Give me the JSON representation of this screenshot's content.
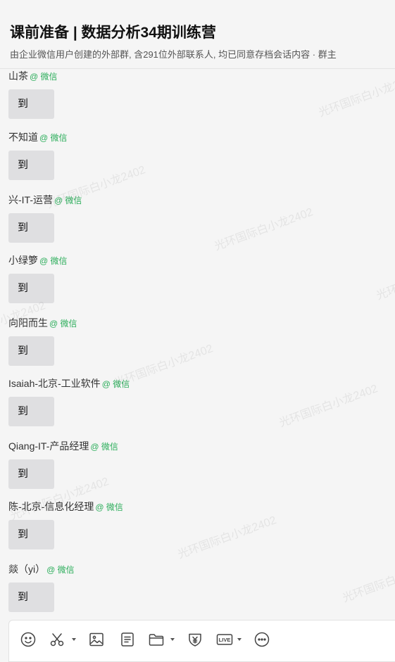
{
  "header": {
    "title": "课前准备 | 数据分析34期训练营",
    "subtitle": "由企业微信用户创建的外部群, 含291位外部联系人,  均已同意存档会话内容  · 群主"
  },
  "messages": [
    {
      "sender": "山茶",
      "source": "@ 微信",
      "text": "到"
    },
    {
      "sender": "不知道",
      "source": "@ 微信",
      "text": "到"
    },
    {
      "sender": "兴-IT-运营",
      "source": "@ 微信",
      "text": "到"
    },
    {
      "sender": "小绿箩",
      "source": "@ 微信",
      "text": "到"
    },
    {
      "sender": "向阳而生",
      "source": "@ 微信",
      "text": "到"
    },
    {
      "sender": "Isaiah-北京-工业软件",
      "source": "@ 微信",
      "text": "到"
    },
    {
      "sender": "Qiang-IT-产品经理",
      "source": "@ 微信",
      "text": "到"
    },
    {
      "sender": "陈-北京-信息化经理",
      "source": "@ 微信",
      "text": "到"
    },
    {
      "sender": "燚（yi）",
      "source": "@ 微信",
      "text": "到"
    }
  ],
  "watermark_text": "光环国际白小龙2402",
  "toolbar": {
    "icons": [
      "emoji-icon",
      "scissors-icon",
      "image-icon",
      "document-icon",
      "folder-icon",
      "red-packet-icon",
      "live-icon",
      "more-icon"
    ],
    "live_label": "LIVE"
  },
  "colors": {
    "source_green": "#2bad5a",
    "bubble": "#dfdfe1",
    "background": "#f5f5f5"
  }
}
